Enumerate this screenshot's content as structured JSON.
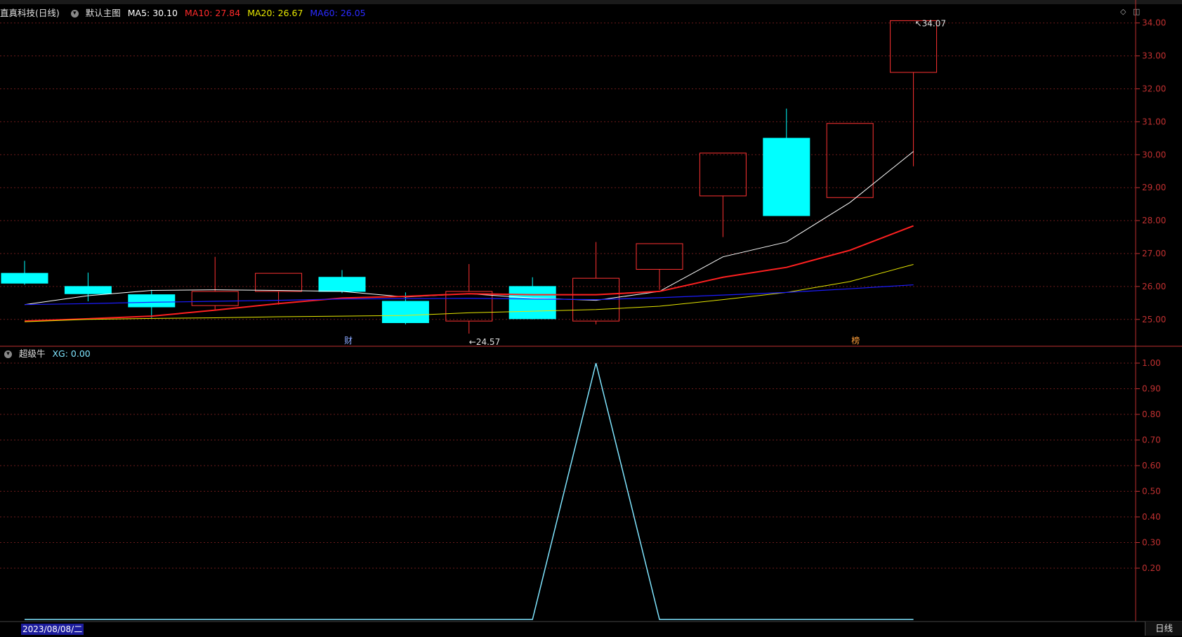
{
  "stock": {
    "title": "直真科技(日线)",
    "chart_name": "默认主图",
    "ma5": "MA5: 30.10",
    "ma10": "MA10: 27.84",
    "ma20": "MA20: 26.67",
    "ma60": "MA60: 26.05"
  },
  "indicator": {
    "name": "超级牛",
    "xg": "XG: 0.00"
  },
  "cursor_date": "2023/08/08/二",
  "period": "日线",
  "markers": {
    "cai": "财",
    "bang": "榜"
  },
  "annotations": {
    "high": "34.07",
    "low": "24.57"
  },
  "colors": {
    "up": "#ff3232",
    "down": "#00ffff",
    "ma5": "#ffffff",
    "ma10": "#ff2020",
    "ma20": "#e6e600",
    "ma60": "#1c1cff",
    "xg": "#7fe5ff",
    "axis": "#c03030"
  },
  "chart_data": [
    {
      "type": "candlestick",
      "title": "直真科技(日线)",
      "series": [
        {
          "name": "K",
          "ohlc": [
            [
              26.4,
              26.78,
              26.05,
              26.1
            ],
            [
              26.0,
              26.42,
              25.55,
              25.78
            ],
            [
              25.75,
              25.9,
              25.05,
              25.38
            ],
            [
              25.42,
              26.9,
              25.3,
              25.85
            ],
            [
              25.85,
              26.4,
              25.45,
              26.4
            ],
            [
              26.28,
              26.5,
              25.8,
              25.85
            ],
            [
              25.55,
              25.82,
              24.85,
              24.9
            ],
            [
              24.95,
              26.68,
              24.57,
              25.85
            ],
            [
              26.0,
              26.28,
              25.0,
              25.02
            ],
            [
              24.95,
              27.35,
              24.85,
              26.25
            ],
            [
              26.52,
              27.3,
              25.9,
              27.3
            ],
            [
              28.75,
              30.05,
              27.5,
              30.05
            ],
            [
              30.5,
              31.4,
              28.15,
              28.15
            ],
            [
              28.7,
              30.95,
              28.7,
              30.95
            ],
            [
              32.5,
              34.07,
              29.65,
              34.07
            ]
          ]
        },
        {
          "name": "MA5",
          "values": [
            25.45,
            25.72,
            25.88,
            25.9,
            25.88,
            25.85,
            25.68,
            25.78,
            25.65,
            25.58,
            25.85,
            26.9,
            27.35,
            28.55,
            30.1
          ]
        },
        {
          "name": "MA10",
          "values": [
            24.95,
            25.02,
            25.1,
            25.28,
            25.48,
            25.65,
            25.7,
            25.78,
            25.75,
            25.75,
            25.85,
            26.28,
            26.58,
            27.1,
            27.84
          ]
        },
        {
          "name": "MA20",
          "values": [
            24.93,
            25.0,
            25.03,
            25.05,
            25.08,
            25.1,
            25.12,
            25.2,
            25.25,
            25.3,
            25.4,
            25.6,
            25.82,
            26.15,
            26.67
          ]
        },
        {
          "name": "MA60",
          "values": [
            25.45,
            25.48,
            25.52,
            25.55,
            25.58,
            25.62,
            25.63,
            25.64,
            25.62,
            25.6,
            25.66,
            25.74,
            25.82,
            25.93,
            26.05
          ]
        }
      ],
      "ylim": [
        24.5,
        34.5
      ],
      "y_ticks": [
        "34.00",
        "33.00",
        "32.00",
        "31.00",
        "30.00",
        "29.00",
        "28.00",
        "27.00",
        "26.00",
        "25.00"
      ],
      "grid": true
    },
    {
      "type": "line",
      "title": "超级牛",
      "series": [
        {
          "name": "XG",
          "values": [
            0,
            0,
            0,
            0,
            0,
            0,
            0,
            0,
            0,
            1,
            0,
            0,
            0,
            0,
            0
          ]
        }
      ],
      "ylim": [
        0,
        1
      ],
      "y_ticks": [
        "1.00",
        "0.90",
        "0.80",
        "0.70",
        "0.60",
        "0.50",
        "0.40",
        "0.30",
        "0.20"
      ],
      "grid": true
    }
  ]
}
